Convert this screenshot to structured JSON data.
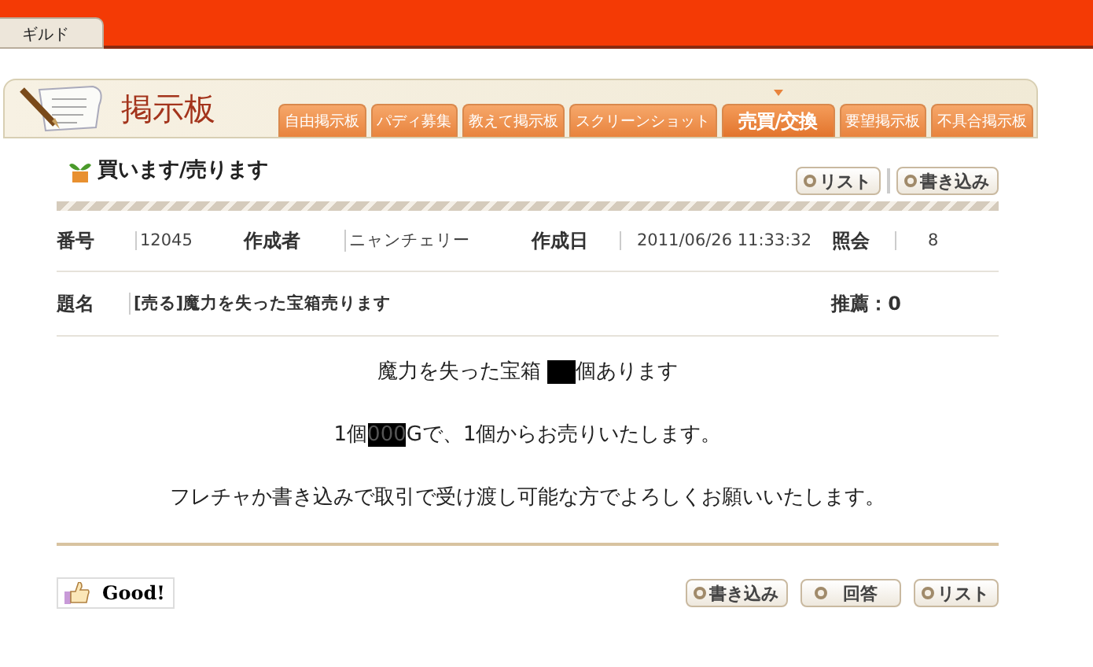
{
  "top_tab": {
    "label": "ギルド"
  },
  "board": {
    "title": "掲示板",
    "tabs": [
      {
        "label": "自由掲示板",
        "selected": false
      },
      {
        "label": "パディ募集",
        "selected": false
      },
      {
        "label": "教えて掲示板",
        "selected": false
      },
      {
        "label": "スクリーンショット",
        "selected": false
      },
      {
        "label": "売買/交換",
        "selected": true
      },
      {
        "label": "要望掲示板",
        "selected": false
      },
      {
        "label": "不具合掲示板",
        "selected": false
      }
    ]
  },
  "section_title": "買います/売ります",
  "top_buttons": [
    "リスト",
    "書き込み"
  ],
  "info": [
    {
      "label": "番号",
      "value": "12045"
    },
    {
      "label": "作成者",
      "value": "ニャンチェリー"
    },
    {
      "label": "作成日",
      "value": "2011/06/26 11:33:32"
    },
    {
      "label": "照会",
      "value": "8"
    }
  ],
  "subject": {
    "label": "題名",
    "value": "[売る]魔力を失った宝箱売ります",
    "recommend": "推薦：0"
  },
  "body": [
    [
      {
        "kind": "text",
        "text": "魔力を失った宝箱 "
      },
      {
        "kind": "redacted"
      },
      {
        "kind": "text",
        "text": "個あります"
      }
    ],
    [
      {
        "kind": "text",
        "text": "1個"
      },
      {
        "kind": "redacted",
        "text": "000"
      },
      {
        "kind": "text",
        "text": "Gで、1個からお売りいたします。"
      }
    ],
    [
      {
        "kind": "text",
        "text": "フレチャか書き込みで取引で受け渡し可能な方でよろしくお願いいたします。"
      }
    ]
  ],
  "good_button": "Good!",
  "bottom_buttons": [
    "書き込み",
    "回答",
    "リスト"
  ]
}
